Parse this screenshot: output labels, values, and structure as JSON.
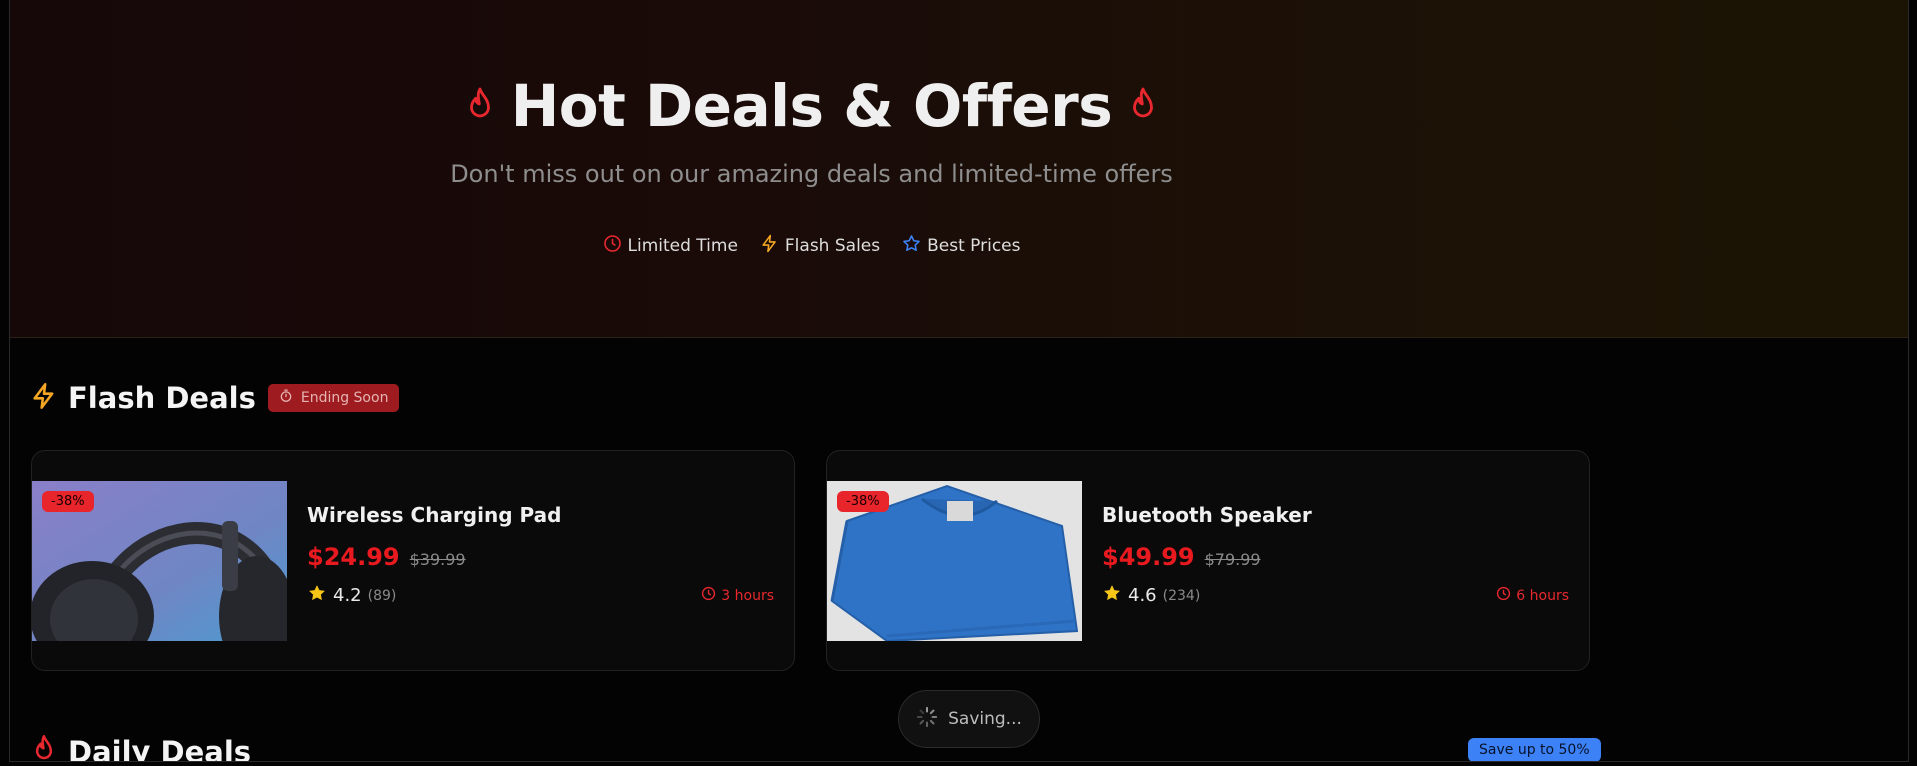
{
  "hero": {
    "title": "Hot Deals & Offers",
    "subtitle": "Don't miss out on our amazing deals and limited-time offers",
    "badges": [
      {
        "label": "Limited Time",
        "icon": "clock-icon",
        "color": "#e8282e"
      },
      {
        "label": "Flash Sales",
        "icon": "lightning-icon",
        "color": "#f5a623"
      },
      {
        "label": "Best Prices",
        "icon": "star-icon",
        "color": "#3c82f6"
      }
    ]
  },
  "flash": {
    "title": "Flash Deals",
    "badge": "Ending Soon",
    "cards": [
      {
        "name": "Wireless Charging Pad",
        "discount": "-38%",
        "price": "$24.99",
        "old_price": "$39.99",
        "rating": "4.2",
        "reviews": "(89)",
        "time_left": "3 hours",
        "image": "headphones"
      },
      {
        "name": "Bluetooth Speaker",
        "discount": "-38%",
        "price": "$49.99",
        "old_price": "$79.99",
        "rating": "4.6",
        "reviews": "(234)",
        "time_left": "6 hours",
        "image": "blue t-shirt"
      }
    ]
  },
  "daily": {
    "title": "Daily Deals",
    "badge": "Save up to 50%"
  },
  "status": {
    "saving": "Saving..."
  },
  "colors": {
    "accent_red": "#e8191f",
    "accent_amber": "#f5a623",
    "accent_blue": "#3c82f6"
  }
}
